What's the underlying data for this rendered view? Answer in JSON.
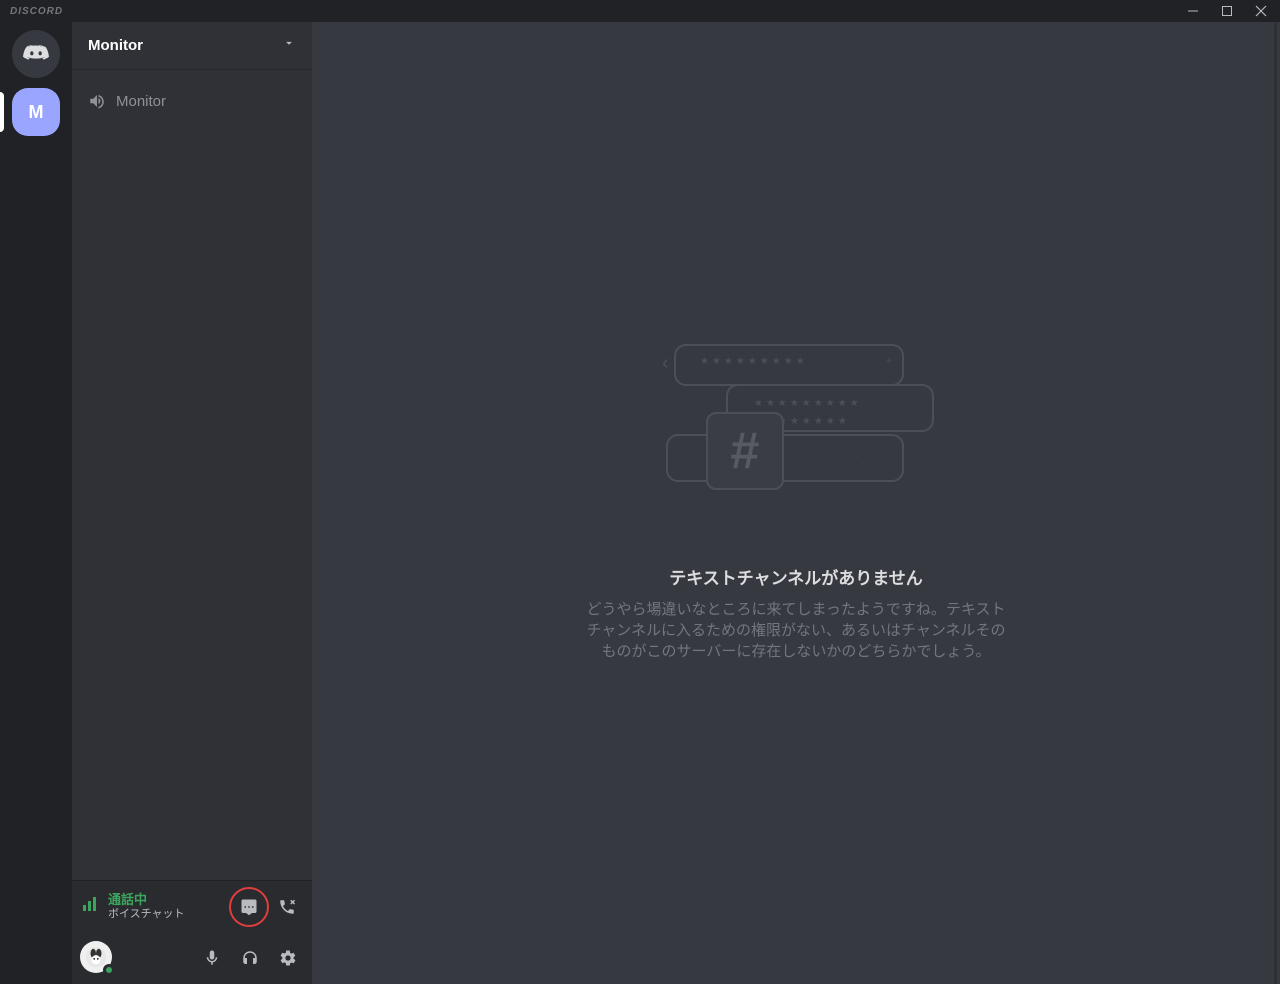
{
  "titlebar": {
    "brand": "DISCORD"
  },
  "guilds": {
    "server_initial": "M"
  },
  "sidebar": {
    "server_name": "Monitor",
    "voice_channel": "Monitor",
    "voice_status": "通話中",
    "voice_sub": "ボイスチャット"
  },
  "empty": {
    "title": "テキストチャンネルがありません",
    "body": "どうやら場違いなところに来てしまったようですね。テキストチャンネルに入るための権限がない、あるいはチャンネルそのものがこのサーバーに存在しないかのどちらかでしょう。"
  }
}
